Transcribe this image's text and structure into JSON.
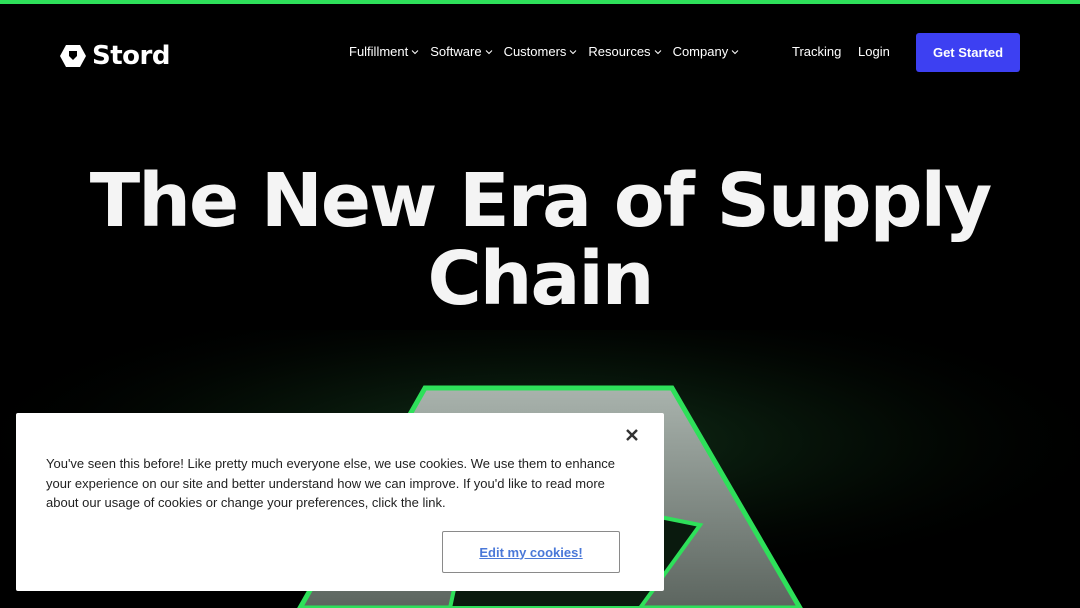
{
  "brand": {
    "name": "Stord",
    "logo_icon": "hexagon-cube-icon",
    "accent_color": "#2ee05a",
    "cta_color": "#3d40f2"
  },
  "nav": {
    "items": [
      {
        "label": "Fulfillment",
        "icon": "chevron-down-icon"
      },
      {
        "label": "Software",
        "icon": "chevron-down-icon"
      },
      {
        "label": "Customers",
        "icon": "chevron-down-icon"
      },
      {
        "label": "Resources",
        "icon": "chevron-down-icon"
      },
      {
        "label": "Company",
        "icon": "chevron-down-icon"
      }
    ],
    "tracking": "Tracking",
    "login": "Login",
    "cta": "Get Started"
  },
  "hero": {
    "title_line1": "The New Era of Supply",
    "title_line2": "Chain"
  },
  "cookie": {
    "text": "You've seen this before! Like pretty much everyone else, we use cookies. We use them to enhance your experience on our site and better understand how we can improve. If you'd like to read more about our usage of cookies or change your preferences, click the link.",
    "button": "Edit my cookies!",
    "close_icon": "close-icon"
  }
}
